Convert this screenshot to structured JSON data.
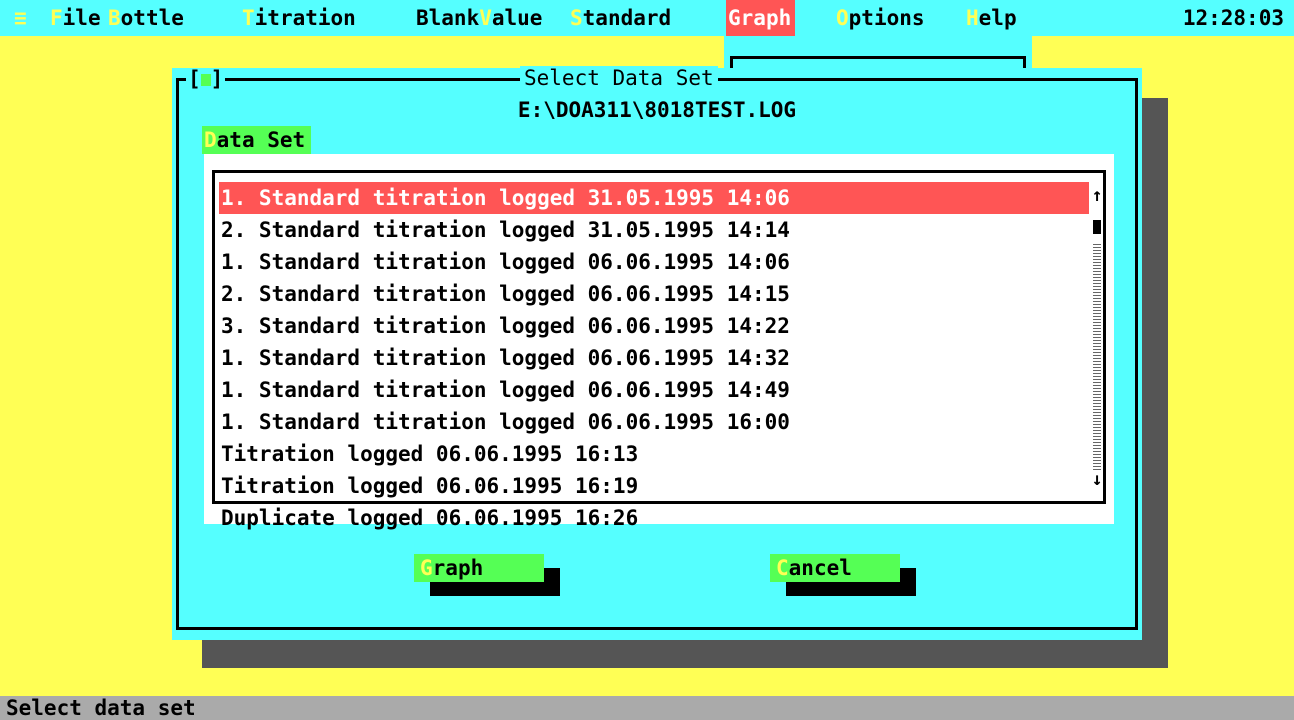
{
  "menubar": {
    "system_icon": "≡",
    "items": [
      {
        "hot": "F",
        "rest": "ile"
      },
      {
        "hot": "B",
        "rest": "ottle"
      },
      {
        "hot": "T",
        "rest": "itration"
      },
      {
        "hot": "",
        "rest": "Blank"
      },
      {
        "hot": "V",
        "rest": "alue"
      },
      {
        "hot": "S",
        "rest": "tandard"
      },
      {
        "hot": "G",
        "rest": "raph"
      },
      {
        "hot": "O",
        "rest": "ptions"
      },
      {
        "hot": "H",
        "rest": "elp"
      }
    ],
    "clock": "12:28:03"
  },
  "dialog": {
    "close_box": "[■]",
    "title": "Select Data Set",
    "path": "E:\\DOA311\\8018TEST.LOG",
    "dataset_label": {
      "hot": "D",
      "rest": "ata Set"
    },
    "list": [
      "1. Standard titration logged 31.05.1995 14:06",
      "2. Standard titration logged 31.05.1995 14:14",
      "1. Standard titration logged 06.06.1995 14:06",
      "2. Standard titration logged 06.06.1995 14:15",
      "3. Standard titration logged 06.06.1995 14:22",
      "1. Standard titration logged 06.06.1995 14:32",
      "1. Standard titration logged 06.06.1995 14:49",
      "1. Standard titration logged 06.06.1995 16:00",
      "Titration logged 06.06.1995 16:13",
      "Titration logged 06.06.1995 16:19",
      "Duplicate logged 06.06.1995 16:26"
    ],
    "selected_index": 0,
    "scroll_up": "↑",
    "scroll_down": "↓",
    "buttons": {
      "graph": {
        "hot": "G",
        "rest": "raph"
      },
      "cancel": {
        "hot": "C",
        "rest": "ancel"
      }
    }
  },
  "statusbar": {
    "text": "Select data set"
  },
  "colors": {
    "desktop": "#ffff55",
    "menubar": "#55ffff",
    "highlight": "#ff5555",
    "button": "#55ff55",
    "shadow": "#555555",
    "status": "#aaaaaa"
  }
}
